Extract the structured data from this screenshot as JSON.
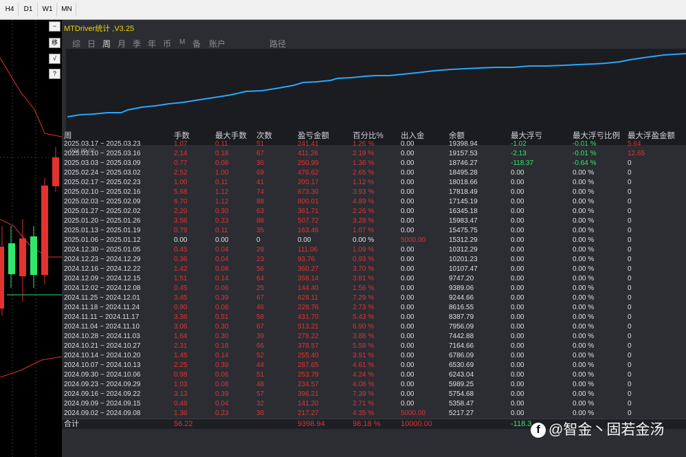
{
  "timeframes": [
    "H4",
    "D1",
    "W1",
    "MN"
  ],
  "side_buttons": [
    "−",
    "移",
    "√",
    "?"
  ],
  "title": "MTDriver统计 ,V3.25",
  "tabs": [
    "综",
    "日",
    "周",
    "月",
    "季",
    "年",
    "币",
    "M",
    "备",
    "账户",
    "路径"
  ],
  "active_tab": "周",
  "curve_start_label": "024.09.02",
  "colors": {
    "curve": "#29a8ff",
    "loss": "#e3322f",
    "gain": "#2ee86c",
    "title": "#f2d200"
  },
  "headers": [
    "周",
    "手数",
    "最大手数",
    "次数",
    "盈亏金额",
    "百分比%",
    "出入金",
    "余额",
    "最大浮亏",
    "最大浮亏比例",
    "最大浮盈金额"
  ],
  "rows": [
    [
      "2025.03.17 ~ 2025.03.23",
      "1.07",
      "0.11",
      "51",
      "241.41",
      "1.26 %",
      "0.00",
      "19398.94",
      "-1.02",
      "-0.01 %",
      "5.64"
    ],
    [
      "2025.03.10 ~ 2025.03.16",
      "2.14",
      "0.18",
      "67",
      "411.26",
      "2.19 %",
      "0.00",
      "19157.53",
      "-2.13",
      "-0.01 %",
      "12.65"
    ],
    [
      "2025.03.03 ~ 2025.03.09",
      "0.77",
      "0.08",
      "36",
      "250.99",
      "1.36 %",
      "0.00",
      "18746.27",
      "-118.37",
      "-0.64 %",
      "0"
    ],
    [
      "2025.02.24 ~ 2025.03.02",
      "2.52",
      "1.00",
      "69",
      "476.62",
      "2.65 %",
      "0.00",
      "18495.28",
      "0.00",
      "0.00 %",
      "0"
    ],
    [
      "2025.02.17 ~ 2025.02.23",
      "1.00",
      "0.11",
      "41",
      "200.17",
      "1.12 %",
      "0.00",
      "18018.66",
      "0.00",
      "0.00 %",
      "0"
    ],
    [
      "2025.02.10 ~ 2025.02.16",
      "5.68",
      "1.12",
      "74",
      "673.30",
      "3.93 %",
      "0.00",
      "17818.49",
      "0.00",
      "0.00 %",
      "0"
    ],
    [
      "2025.02.03 ~ 2025.02.09",
      "6.70",
      "1.12",
      "88",
      "800.01",
      "4.89 %",
      "0.00",
      "17145.19",
      "0.00",
      "0.00 %",
      "0"
    ],
    [
      "2025.01.27 ~ 2025.02.02",
      "2.20",
      "0.30",
      "63",
      "361.71",
      "2.26 %",
      "0.00",
      "16345.18",
      "0.00",
      "0.00 %",
      "0"
    ],
    [
      "2025.01.20 ~ 2025.01.26",
      "3.56",
      "0.23",
      "88",
      "507.72",
      "3.28 %",
      "0.00",
      "15983.47",
      "0.00",
      "0.00 %",
      "0"
    ],
    [
      "2025.01.13 ~ 2025.01.19",
      "0.79",
      "0.11",
      "35",
      "163.46",
      "1.07 %",
      "0.00",
      "15475.75",
      "0.00",
      "0.00 %",
      "0"
    ],
    [
      "2025.01.06 ~ 2025.01.12",
      "0.00",
      "0.00",
      "0",
      "0.00",
      "0.00 %",
      "5000.00",
      "15312.29",
      "0.00",
      "0.00 %",
      "0"
    ],
    [
      "2024.12.30 ~ 2025.01.05",
      "0.45",
      "0.04",
      "28",
      "111.06",
      "1.09 %",
      "0.00",
      "10312.29",
      "0.00",
      "0.00 %",
      "0"
    ],
    [
      "2024.12.23 ~ 2024.12.29",
      "0.36",
      "0.04",
      "23",
      "93.76",
      "0.93 %",
      "0.00",
      "10201.23",
      "0.00",
      "0.00 %",
      "0"
    ],
    [
      "2024.12.16 ~ 2024.12.22",
      "1.42",
      "0.08",
      "56",
      "360.27",
      "3.70 %",
      "0.00",
      "10107.47",
      "0.00",
      "0.00 %",
      "0"
    ],
    [
      "2024.12.09 ~ 2024.12.15",
      "1.51",
      "0.14",
      "64",
      "358.14",
      "3.81 %",
      "0.00",
      "9747.20",
      "0.00",
      "0.00 %",
      "0"
    ],
    [
      "2024.12.02 ~ 2024.12.08",
      "0.45",
      "0.06",
      "25",
      "144.40",
      "1.56 %",
      "0.00",
      "9389.06",
      "0.00",
      "0.00 %",
      "0"
    ],
    [
      "2024.11.25 ~ 2024.12.01",
      "3.45",
      "0.39",
      "67",
      "628.11",
      "7.29 %",
      "0.00",
      "9244.66",
      "0.00",
      "0.00 %",
      "0"
    ],
    [
      "2024.11.18 ~ 2024.11.24",
      "0.90",
      "0.08",
      "46",
      "228.76",
      "2.73 %",
      "0.00",
      "8616.55",
      "0.00",
      "0.00 %",
      "0"
    ],
    [
      "2024.11.11 ~ 2024.11.17",
      "3.36",
      "0.51",
      "58",
      "431.70",
      "5.43 %",
      "0.00",
      "8387.79",
      "0.00",
      "0.00 %",
      "0"
    ],
    [
      "2024.11.04 ~ 2024.11.10",
      "3.06",
      "0.30",
      "67",
      "513.21",
      "6.90 %",
      "0.00",
      "7956.09",
      "0.00",
      "0.00 %",
      "0"
    ],
    [
      "2024.10.28 ~ 2024.11.03",
      "1.64",
      "0.30",
      "39",
      "278.22",
      "3.88 %",
      "0.00",
      "7442.88",
      "0.00",
      "0.00 %",
      "0"
    ],
    [
      "2024.10.21 ~ 2024.10.27",
      "2.31",
      "0.18",
      "66",
      "378.57",
      "5.58 %",
      "0.00",
      "7164.66",
      "0.00",
      "0.00 %",
      "0"
    ],
    [
      "2024.10.14 ~ 2024.10.20",
      "1.45",
      "0.14",
      "52",
      "255.40",
      "3.91 %",
      "0.00",
      "6786.09",
      "0.00",
      "0.00 %",
      "0"
    ],
    [
      "2024.10.07 ~ 2024.10.13",
      "2.25",
      "0.39",
      "44",
      "287.65",
      "4.61 %",
      "0.00",
      "6530.69",
      "0.00",
      "0.00 %",
      "0"
    ],
    [
      "2024.09.30 ~ 2024.10.06",
      "0.98",
      "0.06",
      "51",
      "253.79",
      "4.24 %",
      "0.00",
      "6243.04",
      "0.00",
      "0.00 %",
      "0"
    ],
    [
      "2024.09.23 ~ 2024.09.29",
      "1.03",
      "0.08",
      "48",
      "234.57",
      "4.08 %",
      "0.00",
      "5989.25",
      "0.00",
      "0.00 %",
      "0"
    ],
    [
      "2024.09.16 ~ 2024.09.22",
      "3.13",
      "0.39",
      "57",
      "396.21",
      "7.39 %",
      "0.00",
      "5754.68",
      "0.00",
      "0.00 %",
      "0"
    ],
    [
      "2024.09.09 ~ 2024.09.15",
      "0.48",
      "0.04",
      "32",
      "141.20",
      "2.71 %",
      "0.00",
      "5358.47",
      "0.00",
      "0.00 %",
      "0"
    ],
    [
      "2024.09.02 ~ 2024.09.08",
      "1.36",
      "0.23",
      "38",
      "217.27",
      "4.35 %",
      "5000.00",
      "5217.27",
      "0.00",
      "0.00 %",
      "0"
    ]
  ],
  "footer": {
    "label": "合计",
    "lots": "56.22",
    "pnl": "9398.94",
    "pct": "98.18 %",
    "deposit": "10000.00",
    "maxloss": "-118.3"
  },
  "watermark": "@智金丶固若金汤",
  "watermark_icon": "facebook-icon"
}
